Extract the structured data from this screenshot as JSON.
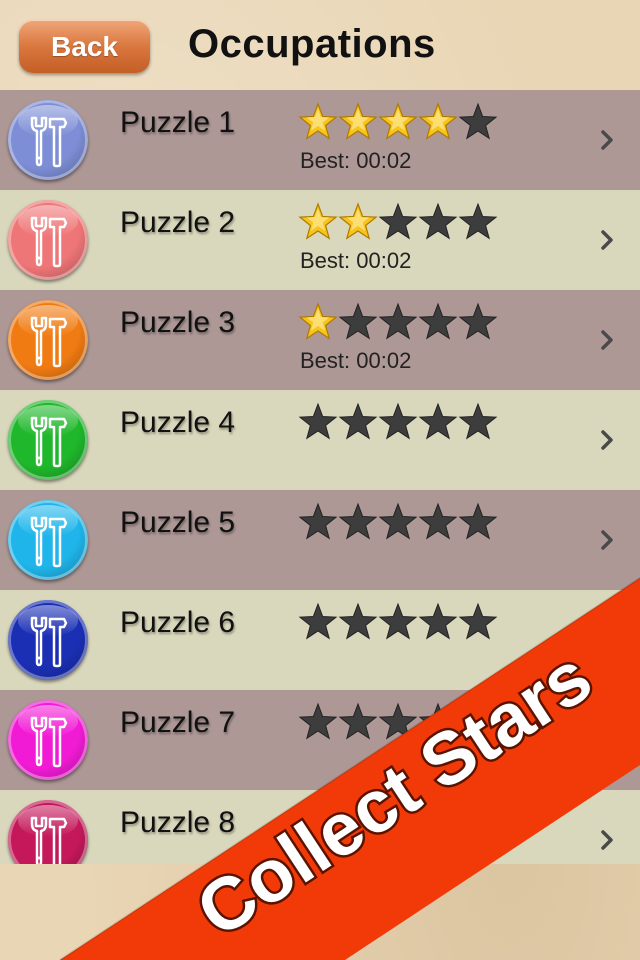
{
  "header": {
    "back_label": "Back",
    "title": "Occupations"
  },
  "rows": [
    {
      "label": "Puzzle 1",
      "icon_color": "#7d8ed6",
      "stars": 4,
      "best": "Best: 00:02"
    },
    {
      "label": "Puzzle 2",
      "icon_color": "#ef7677",
      "stars": 2,
      "best": "Best: 00:02"
    },
    {
      "label": "Puzzle 3",
      "icon_color": "#f07b12",
      "stars": 1,
      "best": "Best: 00:02"
    },
    {
      "label": "Puzzle 4",
      "icon_color": "#1fb72b",
      "stars": 0,
      "best": ""
    },
    {
      "label": "Puzzle 5",
      "icon_color": "#1fb5ea",
      "stars": 0,
      "best": ""
    },
    {
      "label": "Puzzle 6",
      "icon_color": "#1b2fb5",
      "stars": 0,
      "best": ""
    },
    {
      "label": "Puzzle 7",
      "icon_color": "#f21bd5",
      "stars": 0,
      "best": ""
    },
    {
      "label": "Puzzle 8",
      "icon_color": "#c4185a",
      "stars": 0,
      "best": ""
    }
  ],
  "max_stars": 5,
  "banner": {
    "text": "Collect Stars",
    "color": "#f23a08"
  },
  "colors": {
    "gold_star": "#f7c41b",
    "empty_star": "#3d3d3d"
  }
}
